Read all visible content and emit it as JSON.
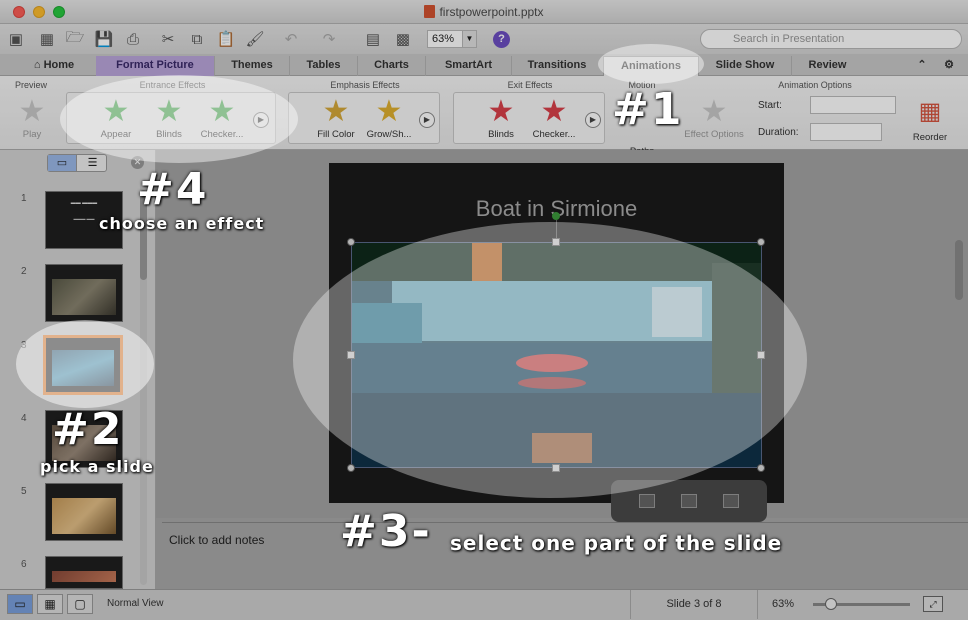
{
  "window": {
    "title": "firstpowerpoint.pptx"
  },
  "toolbar": {
    "zoom": "63%",
    "search_placeholder": "Search in Presentation"
  },
  "tabs": [
    "Home",
    "Format Picture",
    "Themes",
    "Tables",
    "Charts",
    "SmartArt",
    "Transitions",
    "Animations",
    "Slide Show",
    "Review"
  ],
  "active_tab": "Animations",
  "ribbon": {
    "preview": {
      "label": "Preview",
      "play": "Play"
    },
    "entrance": {
      "label": "Entrance Effects",
      "items": [
        "Appear",
        "Blinds",
        "Checker..."
      ],
      "color": "#3fae49"
    },
    "emphasis": {
      "label": "Emphasis Effects",
      "items": [
        "Fill Color",
        "Grow/Sh..."
      ],
      "color": "#e0b030"
    },
    "exit": {
      "label": "Exit Effects",
      "items": [
        "Blinds",
        "Checker..."
      ],
      "color": "#d9404a"
    },
    "motion": {
      "label": "Motion",
      "paths": "Paths"
    },
    "effect_options": "Effect Options",
    "animation_options": {
      "label": "Animation Options",
      "start_label": "Start:",
      "duration_label": "Duration:"
    },
    "reorder": "Reorder"
  },
  "slides": [
    {
      "num": "1"
    },
    {
      "num": "2"
    },
    {
      "num": "3"
    },
    {
      "num": "4"
    },
    {
      "num": "5"
    },
    {
      "num": "6"
    }
  ],
  "current_slide": {
    "title": "Boat in Sirmione"
  },
  "notes_placeholder": "Click to add notes",
  "statusbar": {
    "view": "Normal View",
    "slide_info": "Slide 3 of 8",
    "zoom": "63%"
  },
  "annotations": {
    "step1": "#1",
    "step2": "#2",
    "step2_text": "pick a slide",
    "step3": "#3-",
    "step3_text": "select one part of the slide",
    "step4": "#4",
    "step4_text": "choose an effect"
  },
  "colors": {
    "accent_tab": "#bba6dc",
    "selection": "#f07a1e"
  }
}
